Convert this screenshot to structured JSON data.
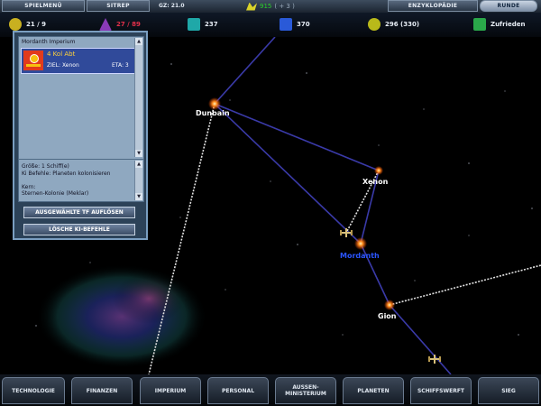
{
  "topbar": {
    "spielmenu": "SPIELMENÜ",
    "sitrep": "SITREP",
    "stardate": "GZ: 21.0",
    "credits": "915",
    "credits_delta": "( + 3 )",
    "encyclopedia": "ENZYKLOPÄDIE",
    "runde": "RUNDE"
  },
  "resources": {
    "r1": "21 / 9",
    "r2": "27 / 89",
    "r3": "237",
    "r4": "370",
    "r5": "296 (330)",
    "r6": "Zufrieden"
  },
  "colors": {
    "r2_value": "#e2304a",
    "credits": "#2ad12a",
    "home_system": "#2a55ff",
    "route": "#3a3aa8",
    "fleet_path": "#e8e8e8"
  },
  "systems": {
    "dunbain": "Dunbain",
    "xenon": "Xenon",
    "mordanth": "Mordanth",
    "gion": "Gion"
  },
  "fleet_panel": {
    "empire": "Mordanth Imperium",
    "fleet_name": "4 Kol Abt",
    "target": "ZIEL: Xenon",
    "eta": "ETA: 3",
    "info": [
      "Größe: 1 Schiff(e)",
      "Ki Befehle: Planeten kolonisieren",
      "",
      "Kern:",
      "Sternen-Kolonie (Meklar)"
    ],
    "btn_disband": "AUSGEWÄHLTE TF AUFLÖSEN",
    "btn_clear_ai": "LÖSCHE KI-BEFEHLE"
  },
  "tabs": {
    "technologie": "TECHNOLOGIE",
    "finanzen": "FINANZEN",
    "imperium": "IMPERIUM",
    "personal": "PERSONAL",
    "aussen_1": "AUSSEN-",
    "aussen_2": "MINISTERIUM",
    "planeten": "PLANETEN",
    "schiffswerft": "SCHIFFSWERFT",
    "sieg": "SIEG"
  }
}
